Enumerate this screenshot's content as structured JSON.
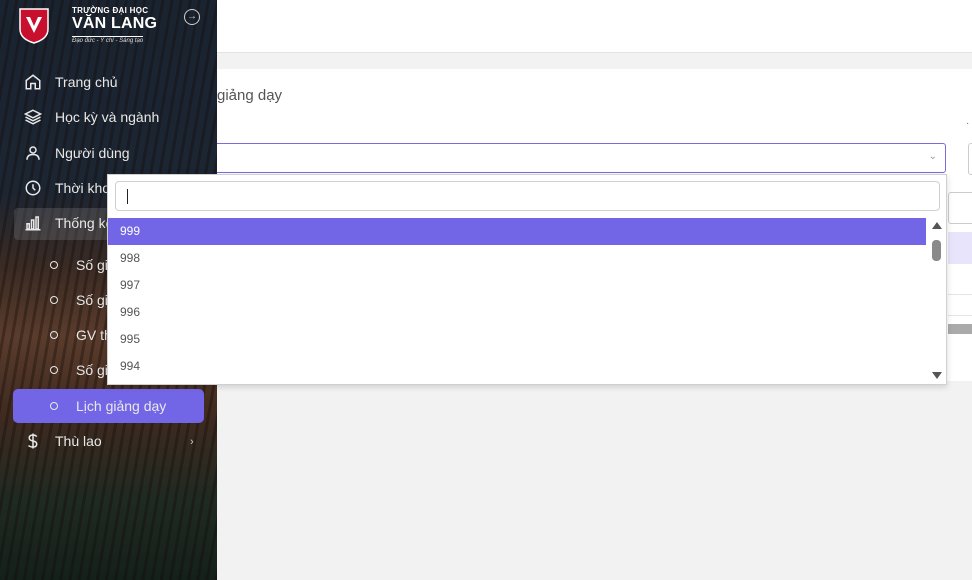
{
  "brand": {
    "school_small": "TRƯỜNG ĐẠI HỌC",
    "school_name": "VĂN LANG",
    "tagline": "Đạo đức - Ý chí - Sáng tạo",
    "color_red": "#c8102e"
  },
  "sidebar": {
    "items": [
      {
        "label": "Trang chủ",
        "icon": "home-icon"
      },
      {
        "label": "Học kỳ và ngành",
        "icon": "layers-icon"
      },
      {
        "label": "Người dùng",
        "icon": "user-icon"
      },
      {
        "label": "Thời khoá biểu",
        "icon": "clock-icon"
      },
      {
        "label": "Thống kê",
        "icon": "bar-chart-icon"
      }
    ],
    "sub_items": [
      {
        "label": "Số giờ"
      },
      {
        "label": "Số giờ"
      },
      {
        "label": "GV th"
      },
      {
        "label": "Số gi"
      },
      {
        "label": "Lịch giảng dạy"
      }
    ],
    "thu_lao": {
      "label": "Thù lao",
      "icon": "dollar-icon"
    }
  },
  "main": {
    "title": "giảng dạy"
  },
  "dropdown": {
    "search_value": "",
    "options": [
      "999",
      "998",
      "997",
      "996",
      "995",
      "994"
    ],
    "selected_index": 0
  },
  "colors": {
    "accent": "#7366e6",
    "sidebar_text": "#e8e8e8"
  }
}
